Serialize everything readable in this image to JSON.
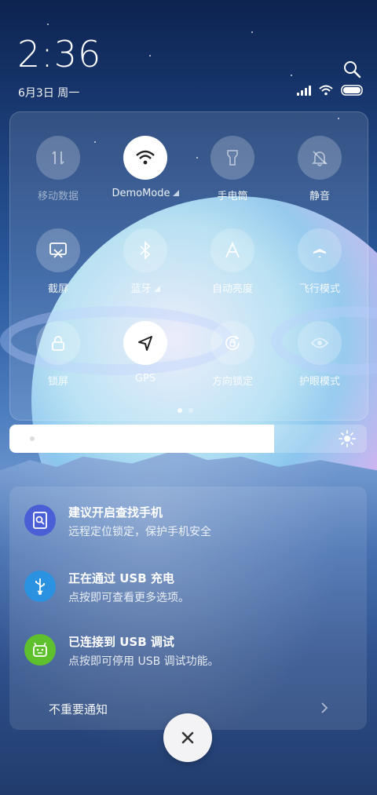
{
  "status": {
    "time": "2:36",
    "date": "6月3日 周一"
  },
  "quick_settings": {
    "row1": [
      {
        "label": "移动数据",
        "icon": "mobile-data-icon",
        "active": false
      },
      {
        "label": "DemoMode",
        "icon": "wifi-icon",
        "active": true
      },
      {
        "label": "手电筒",
        "icon": "flashlight-icon",
        "active": false
      },
      {
        "label": "静音",
        "icon": "bell-mute-icon",
        "active": false
      }
    ],
    "row2": [
      {
        "label": "截屏",
        "icon": "screenshot-icon",
        "active": false
      },
      {
        "label": "蓝牙",
        "icon": "bluetooth-icon",
        "active": false
      },
      {
        "label": "自动亮度",
        "icon": "auto-brightness-icon",
        "active": false
      },
      {
        "label": "飞行模式",
        "icon": "airplane-icon",
        "active": false
      }
    ],
    "row3": [
      {
        "label": "锁屏",
        "icon": "lock-icon",
        "active": false
      },
      {
        "label": "GPS",
        "icon": "gps-icon",
        "active": true
      },
      {
        "label": "方向锁定",
        "icon": "rotation-lock-icon",
        "active": false
      },
      {
        "label": "护眼模式",
        "icon": "eye-icon",
        "active": false
      }
    ],
    "page_count": 2,
    "current_page": 1
  },
  "brightness": {
    "level": 0.74
  },
  "notifications": [
    {
      "title": "建议开启查找手机",
      "subtitle": "远程定位锁定，保护手机安全",
      "icon": "find-phone-icon",
      "color": "#4a5fd6"
    },
    {
      "title": "正在通过 USB 充电",
      "subtitle": "点按即可查看更多选项。",
      "icon": "usb-icon",
      "color": "#2a92e0"
    },
    {
      "title": "已连接到 USB 调试",
      "subtitle": "点按即可停用 USB 调试功能。",
      "icon": "android-icon",
      "color": "#5fc02d"
    }
  ],
  "unimportant": {
    "label": "不重要通知"
  },
  "colors": {
    "accent_white": "#ffffff"
  }
}
